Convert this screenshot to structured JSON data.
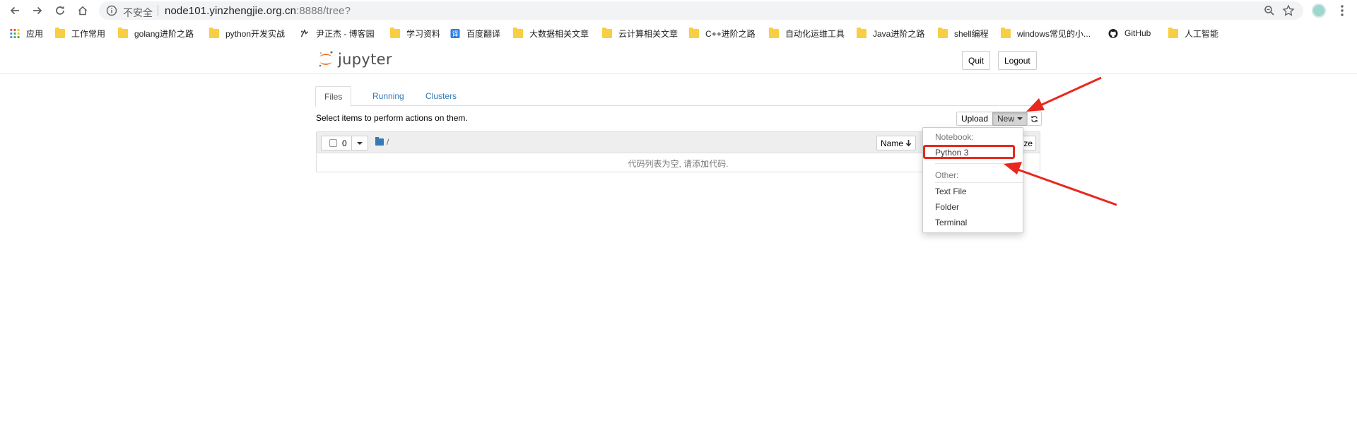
{
  "browser": {
    "insecure_label": "不安全",
    "url_host": "node101.yinzhengjie.org.cn",
    "url_rest": ":8888/tree?"
  },
  "bookmarks": [
    {
      "label": "应用",
      "icon": "apps-grid-icon"
    },
    {
      "label": "工作常用",
      "icon": "folder-icon"
    },
    {
      "label": "golang进阶之路",
      "icon": "folder-icon"
    },
    {
      "label": "python开发实战",
      "icon": "folder-icon"
    },
    {
      "label": "尹正杰 - 博客园",
      "icon": "cnblogs-icon"
    },
    {
      "label": "学习资料",
      "icon": "folder-icon"
    },
    {
      "label": "百度翻译",
      "icon": "baidu-translate-icon"
    },
    {
      "label": "大数据相关文章",
      "icon": "folder-icon"
    },
    {
      "label": "云计算相关文章",
      "icon": "folder-icon"
    },
    {
      "label": "C++进阶之路",
      "icon": "folder-icon"
    },
    {
      "label": "自动化运维工具",
      "icon": "folder-icon"
    },
    {
      "label": "Java进阶之路",
      "icon": "folder-icon"
    },
    {
      "label": "shell编程",
      "icon": "folder-icon"
    },
    {
      "label": "windows常见的小...",
      "icon": "folder-icon"
    },
    {
      "label": "GitHub",
      "icon": "github-icon"
    },
    {
      "label": "人工智能",
      "icon": "folder-icon"
    }
  ],
  "jupyter": {
    "logo_text": "jupyter",
    "quit": "Quit",
    "logout": "Logout",
    "tabs": [
      "Files",
      "Running",
      "Clusters"
    ],
    "select_hint": "Select items to perform actions on them.",
    "upload": "Upload",
    "new": "New",
    "selected_count": "0",
    "breadcrumb": "/",
    "name_sort": "Name",
    "size_stub": "ze",
    "empty_message": "代码列表为空, 请添加代码."
  },
  "new_menu": {
    "notebook_header": "Notebook:",
    "notebook_items": [
      "Python 3"
    ],
    "other_header": "Other:",
    "other_items": [
      "Text File",
      "Folder",
      "Terminal"
    ]
  },
  "colors": {
    "accent_link": "#337ab7",
    "annotation_red": "#e8281e",
    "jupyter_orange": "#f37726"
  }
}
